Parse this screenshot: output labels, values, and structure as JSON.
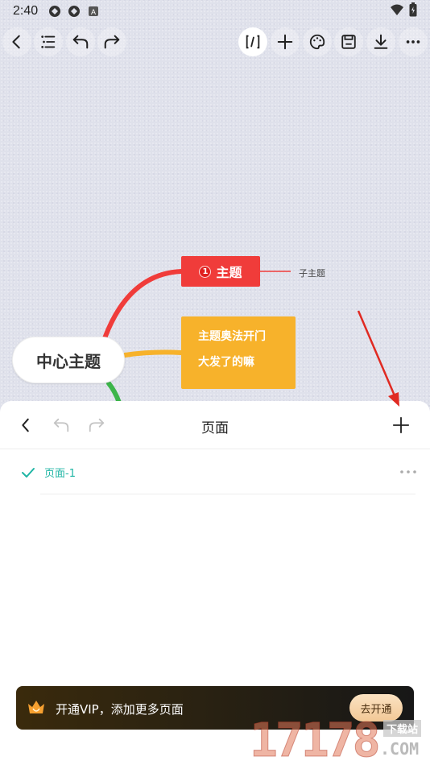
{
  "status_bar": {
    "time": "2:40"
  },
  "mindmap": {
    "center_topic": "中心主题",
    "topic_red": {
      "badge": "1",
      "label": "主题"
    },
    "subtopic": "子主题",
    "topic_orange": {
      "line1": "主题奥法开门",
      "line2": "大发了的嘛"
    },
    "colors": {
      "red": "#f03c3a",
      "orange": "#f7b22b",
      "green": "#3cb54a"
    }
  },
  "toolbar": {
    "icons": [
      "back-icon",
      "outline-icon",
      "undo-icon",
      "redo-icon",
      "formula-icon",
      "add-icon",
      "palette-icon",
      "save-icon",
      "download-icon",
      "more-icon"
    ]
  },
  "sheet": {
    "title": "页面",
    "pages": [
      {
        "name": "页面-1",
        "selected": true
      }
    ]
  },
  "vip_banner": {
    "text": "开通VIP，添加更多页面",
    "button": "去开通"
  },
  "watermark": {
    "digits": "17178",
    "tag": "下载站",
    "domain": ".COM"
  },
  "accent_color": "#1fb5a4"
}
